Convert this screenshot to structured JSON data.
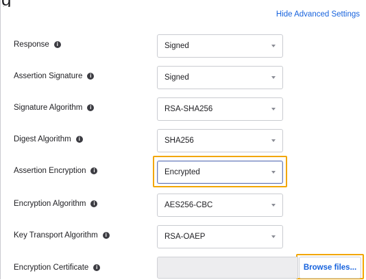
{
  "header": {
    "hide_advanced_link": "Hide Advanced Settings"
  },
  "fields": [
    {
      "label": "Response",
      "value": "Signed"
    },
    {
      "label": "Assertion Signature",
      "value": "Signed"
    },
    {
      "label": "Signature Algorithm",
      "value": "RSA-SHA256"
    },
    {
      "label": "Digest Algorithm",
      "value": "SHA256"
    },
    {
      "label": "Assertion Encryption",
      "value": "Encrypted"
    },
    {
      "label": "Encryption Algorithm",
      "value": "AES256-CBC"
    },
    {
      "label": "Key Transport Algorithm",
      "value": "RSA-OAEP"
    }
  ],
  "certificate": {
    "label": "Encryption Certificate",
    "button_label": "Browse files..."
  },
  "icons": {
    "help": "help-circle-icon",
    "dropdown": "chevron-down-icon"
  },
  "colors": {
    "link": "#1662dd",
    "highlight": "#f2a600"
  }
}
